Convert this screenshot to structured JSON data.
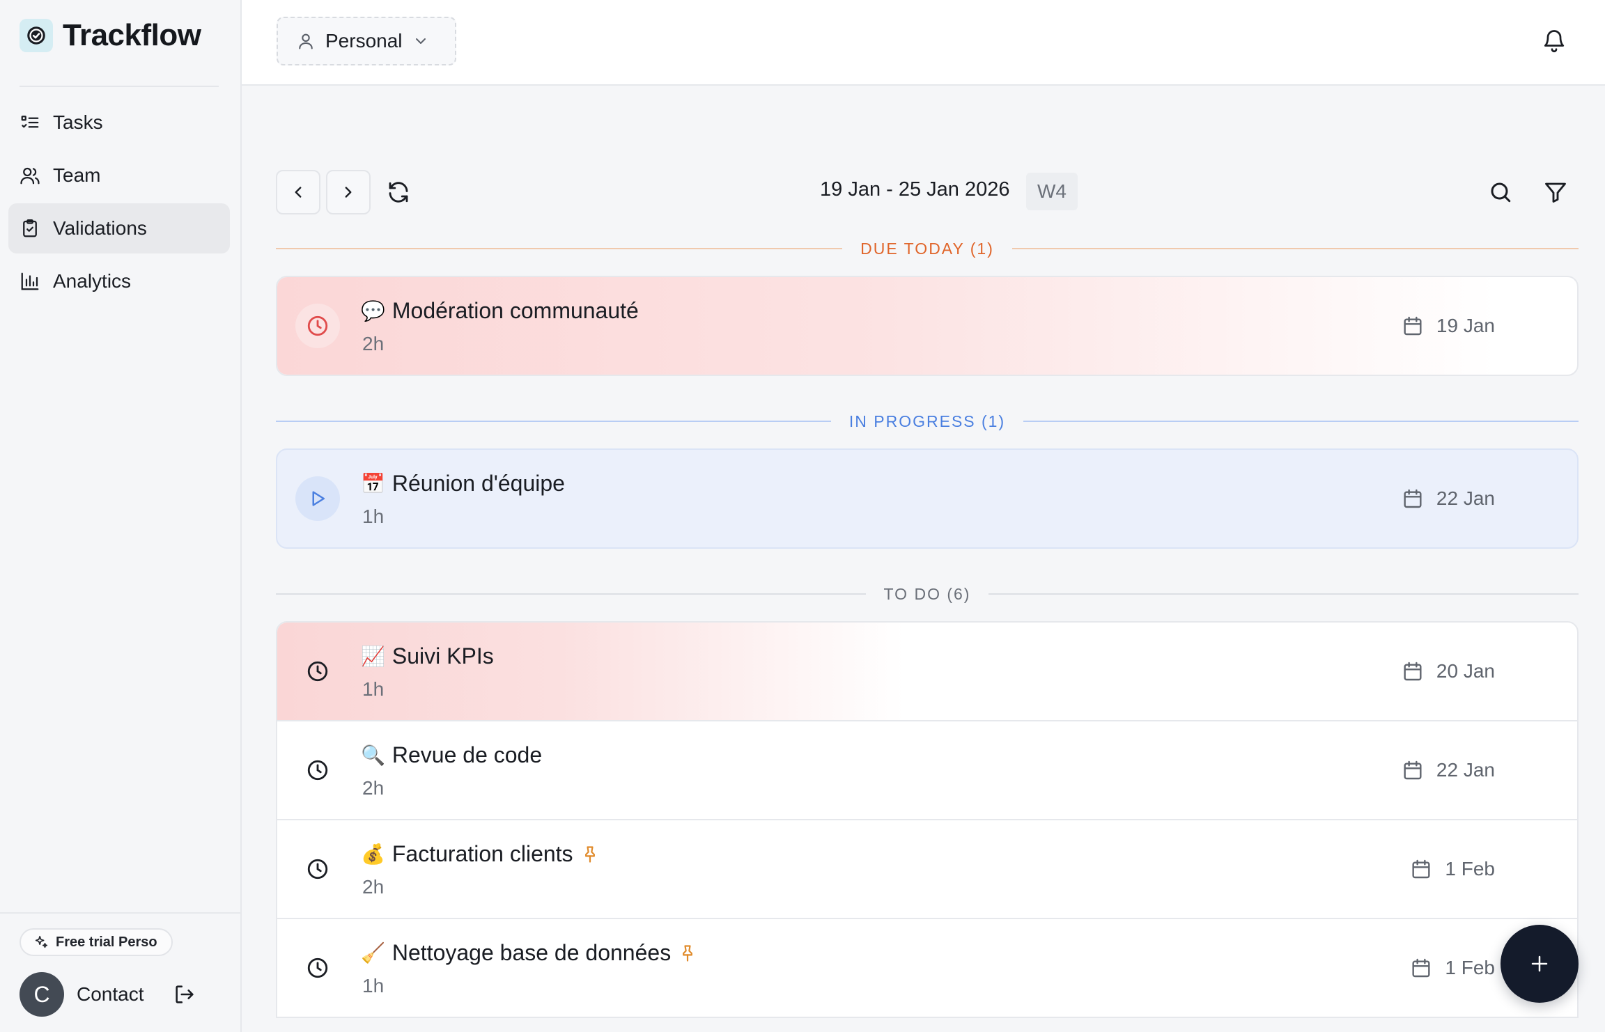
{
  "app": {
    "name": "Trackflow"
  },
  "sidebar": {
    "items": [
      {
        "label": "Tasks",
        "icon": "list-checks-icon"
      },
      {
        "label": "Team",
        "icon": "users-icon"
      },
      {
        "label": "Validations",
        "icon": "clipboard-check-icon",
        "active": true
      },
      {
        "label": "Analytics",
        "icon": "bar-chart-icon"
      }
    ],
    "trial_label": "Free trial Perso",
    "user": {
      "initial": "C",
      "name": "Contact"
    }
  },
  "topbar": {
    "workspace": "Personal"
  },
  "toolbar": {
    "range": "19 Jan - 25 Jan 2026",
    "week": "W4"
  },
  "sections": [
    {
      "label": "DUE TODAY (1)",
      "color": "#e0652a",
      "tasks": [
        {
          "emoji": "💬",
          "title": "Modération communauté",
          "duration": "2h",
          "date": "19 Jan"
        }
      ]
    },
    {
      "label": "IN PROGRESS (1)",
      "color": "#4a7fe0",
      "tasks": [
        {
          "emoji": "📅",
          "title": "Réunion d'équipe",
          "duration": "1h",
          "date": "22 Jan"
        }
      ]
    },
    {
      "label": "TO DO (6)",
      "color": "#6b7079",
      "tasks": [
        {
          "emoji": "📈",
          "title": "Suivi KPIs",
          "duration": "1h",
          "date": "20 Jan"
        },
        {
          "emoji": "🔍",
          "title": "Revue de code",
          "duration": "2h",
          "date": "22 Jan"
        },
        {
          "emoji": "💰",
          "title": "Facturation clients",
          "duration": "2h",
          "date": "1 Feb",
          "pinned": true
        },
        {
          "emoji": "🧹",
          "title": "Nettoyage base de données",
          "duration": "1h",
          "date": "1 Feb",
          "pinned": true
        }
      ]
    }
  ],
  "colors": {
    "accent": "#141b2b",
    "due": "#e0652a",
    "progress": "#4a7fe0",
    "overdue_bg": "#fbd7d7",
    "progress_bg": "#ebf0fb"
  }
}
